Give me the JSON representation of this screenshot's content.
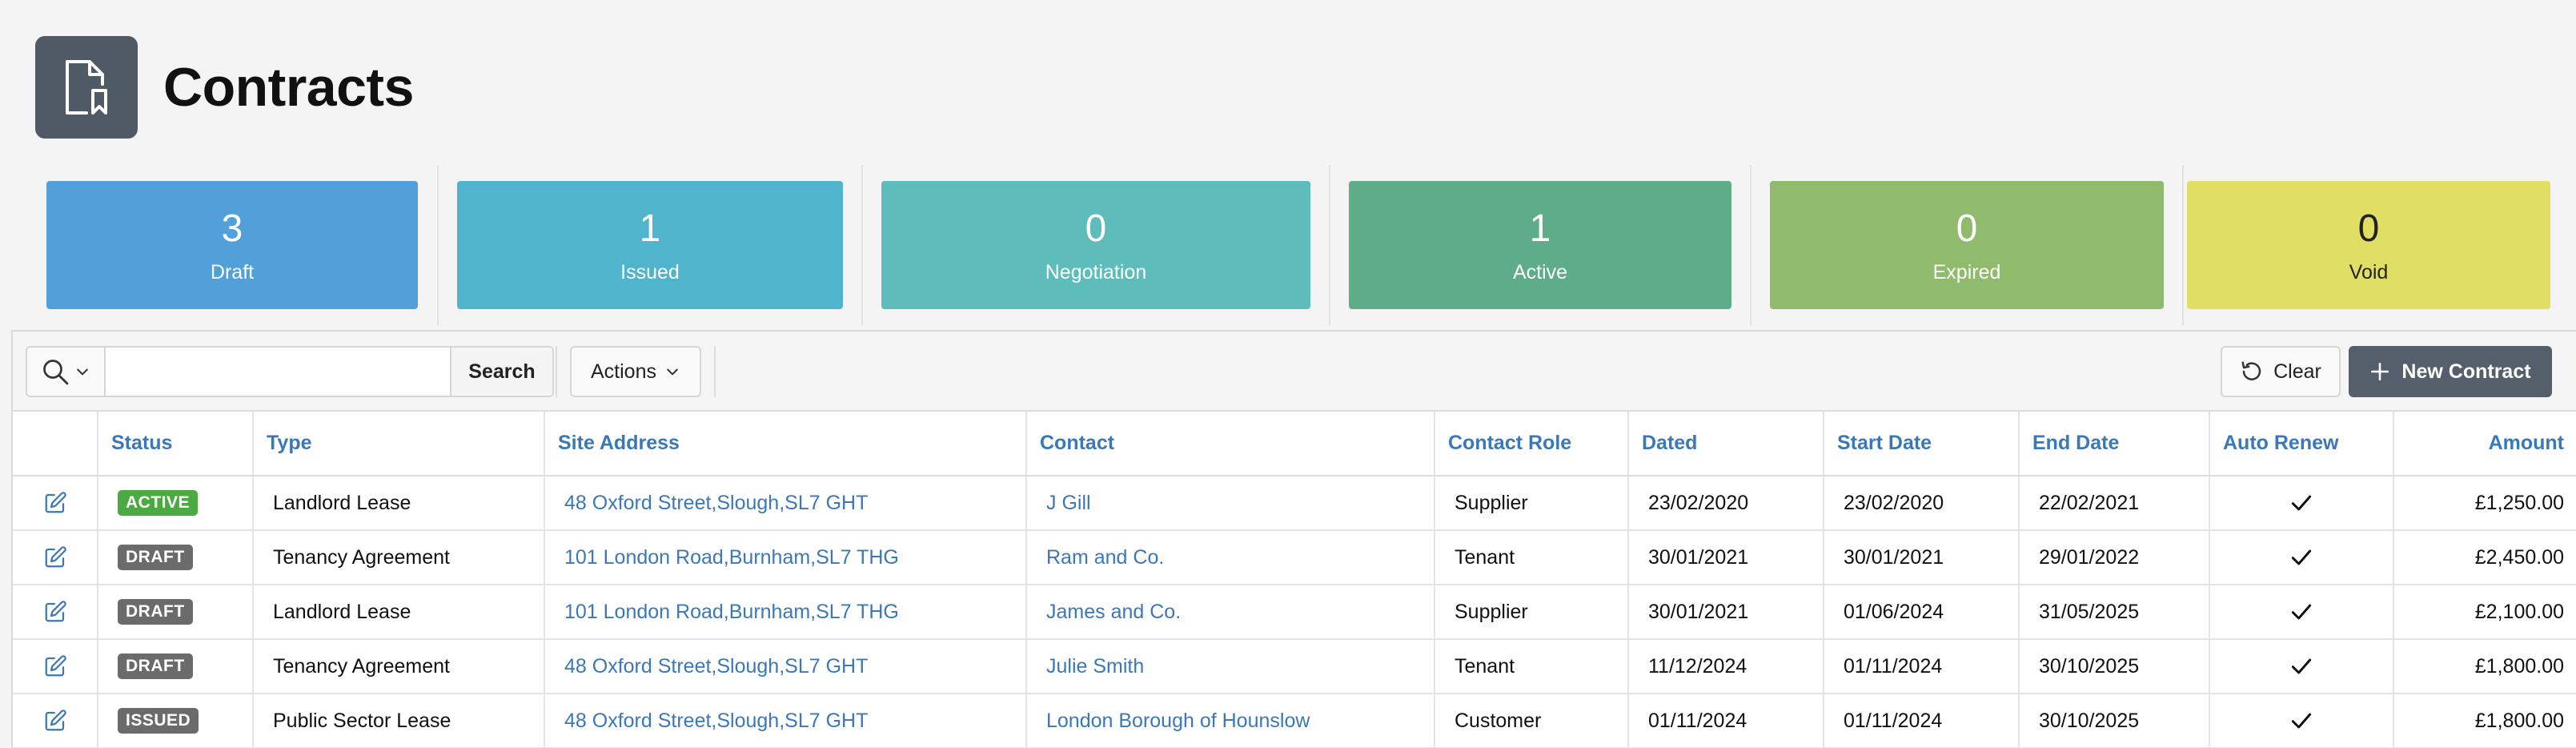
{
  "page": {
    "title": "Contracts",
    "icon": "contract-document-icon"
  },
  "stats": [
    {
      "key": "draft",
      "count": "3",
      "label": "Draft",
      "color": "#51a0d9",
      "text_color": "#ffffff"
    },
    {
      "key": "issued",
      "count": "1",
      "label": "Issued",
      "color": "#50b4cc",
      "text_color": "#ffffff"
    },
    {
      "key": "negotiation",
      "count": "0",
      "label": "Negotiation",
      "color": "#5ebdbb",
      "text_color": "#ffffff"
    },
    {
      "key": "active",
      "count": "1",
      "label": "Active",
      "color": "#5eac88",
      "text_color": "#ffffff"
    },
    {
      "key": "expired",
      "count": "0",
      "label": "Expired",
      "color": "#90ba6c",
      "text_color": "#ffffff"
    },
    {
      "key": "void",
      "count": "0",
      "label": "Void",
      "color": "#e0de63",
      "text_color": "#222222"
    }
  ],
  "toolbar": {
    "search_placeholder": "",
    "search_value": "",
    "search_label": "Search",
    "actions_label": "Actions",
    "clear_label": "Clear",
    "new_label": "New Contract"
  },
  "table": {
    "columns": [
      "",
      "Status",
      "Type",
      "Site Address",
      "Contact",
      "Contact Role",
      "Dated",
      "Start Date",
      "End Date",
      "Auto Renew",
      "Amount"
    ],
    "status_colors": {
      "ACTIVE": "#4caa43",
      "DRAFT": "#6b6b6b",
      "ISSUED": "#6b6b6b"
    },
    "rows": [
      {
        "status": "ACTIVE",
        "type": "Landlord Lease",
        "site_address": "48 Oxford Street,Slough,SL7 GHT",
        "contact": "J Gill",
        "contact_role": "Supplier",
        "dated": "23/02/2020",
        "start_date": "23/02/2020",
        "end_date": "22/02/2021",
        "auto_renew": true,
        "amount": "£1,250.00"
      },
      {
        "status": "DRAFT",
        "type": "Tenancy Agreement",
        "site_address": "101 London Road,Burnham,SL7 THG",
        "contact": "Ram and Co.",
        "contact_role": "Tenant",
        "dated": "30/01/2021",
        "start_date": "30/01/2021",
        "end_date": "29/01/2022",
        "auto_renew": true,
        "amount": "£2,450.00"
      },
      {
        "status": "DRAFT",
        "type": "Landlord Lease",
        "site_address": "101 London Road,Burnham,SL7 THG",
        "contact": "James and Co.",
        "contact_role": "Supplier",
        "dated": "30/01/2021",
        "start_date": "01/06/2024",
        "end_date": "31/05/2025",
        "auto_renew": true,
        "amount": "£2,100.00"
      },
      {
        "status": "DRAFT",
        "type": "Tenancy Agreement",
        "site_address": "48 Oxford Street,Slough,SL7 GHT",
        "contact": "Julie Smith",
        "contact_role": "Tenant",
        "dated": "11/12/2024",
        "start_date": "01/11/2024",
        "end_date": "30/10/2025",
        "auto_renew": true,
        "amount": "£1,800.00"
      },
      {
        "status": "ISSUED",
        "type": "Public Sector Lease",
        "site_address": "48 Oxford Street,Slough,SL7 GHT",
        "contact": "London Borough of Hounslow",
        "contact_role": "Customer",
        "dated": "01/11/2024",
        "start_date": "01/11/2024",
        "end_date": "30/10/2025",
        "auto_renew": true,
        "amount": "£1,800.00"
      }
    ]
  }
}
